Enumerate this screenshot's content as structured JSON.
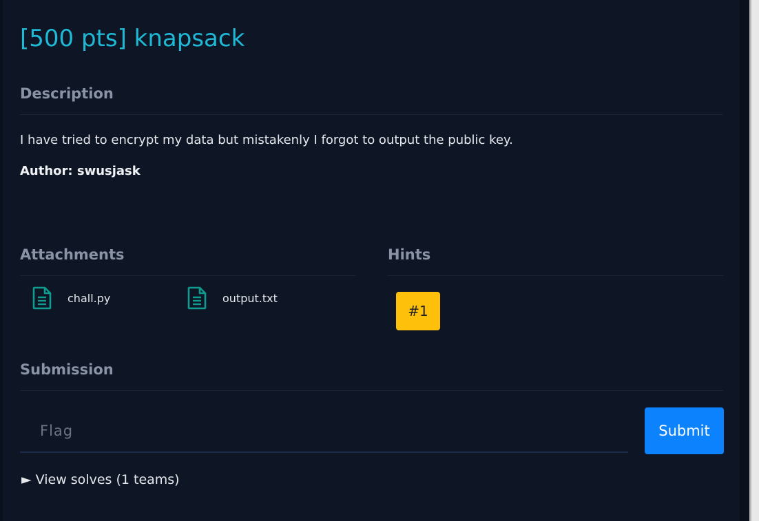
{
  "challenge": {
    "title": "[500 pts] knapsack"
  },
  "description": {
    "heading": "Description",
    "text": "I have tried to encrypt my data but mistakenly I forgot to output the public key.",
    "author": "Author: swusjask"
  },
  "attachments": {
    "heading": "Attachments",
    "files": [
      {
        "name": "chall.py",
        "icon": "file-text-icon"
      },
      {
        "name": "output.txt",
        "icon": "file-text-icon"
      }
    ],
    "icon_color": "#0f9b8e"
  },
  "hints": {
    "heading": "Hints",
    "items": [
      {
        "label": "#1",
        "color": "#ffc00b"
      }
    ]
  },
  "submission": {
    "heading": "Submission",
    "flag_placeholder": "Flag",
    "flag_value": "",
    "submit_label": "Submit",
    "submit_color": "#0d82fd"
  },
  "solves": {
    "label": "► View solves (1 teams)"
  },
  "colors": {
    "background": "#0e1626",
    "title": "#1fb9d6",
    "heading": "#8a93a6",
    "text": "#e6e8ec"
  }
}
